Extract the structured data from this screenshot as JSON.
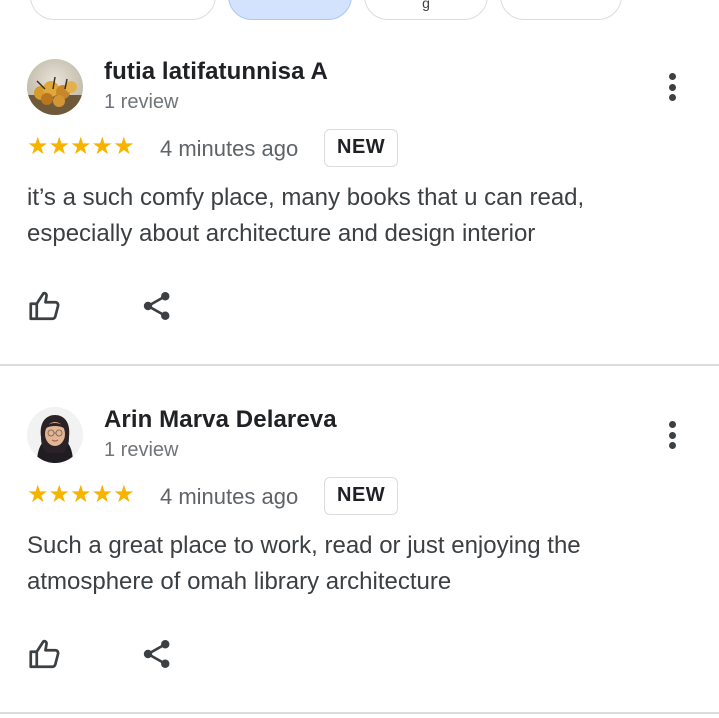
{
  "filter_chips": [
    {
      "label": ""
    },
    {
      "label": ""
    },
    {
      "label": "g"
    },
    {
      "label": ""
    }
  ],
  "reviews": [
    {
      "author": "futia latifatunnisa A",
      "reviewer_meta": "1 review",
      "stars": "★★★★★",
      "rating": 5,
      "time": "4 minutes ago",
      "badge": "NEW",
      "text_line1": "it’s a such comfy place, many books that u can read,",
      "text_line2": "especially about architecture and design interior"
    },
    {
      "author": "Arin Marva Delareva",
      "reviewer_meta": "1 review",
      "stars": "★★★★★",
      "rating": 5,
      "time": "4 minutes ago",
      "badge": "NEW",
      "text_line1": "Such a great place to work, read or just enjoying the",
      "text_line2": "atmosphere of omah library architecture"
    }
  ],
  "colors": {
    "star": "#f6b400",
    "selected_chip": "#d3e3fd",
    "divider": "#dadce0"
  },
  "icons": {
    "like": "thumbs-up-icon",
    "share": "share-icon",
    "more": "more-vert-icon"
  }
}
